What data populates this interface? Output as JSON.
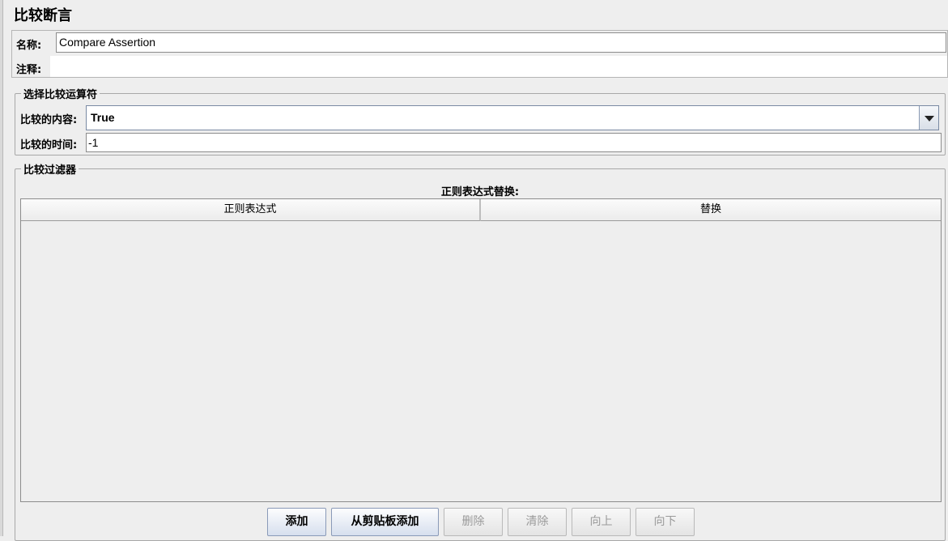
{
  "page": {
    "title": "比较断言"
  },
  "name_panel": {
    "name_label": "名称:",
    "name_value": "Compare Assertion",
    "comment_label": "注释:",
    "comment_value": ""
  },
  "operator_group": {
    "legend": "选择比较运算符",
    "content_label": "比较的内容:",
    "content_value": "True",
    "time_label": "比较的时间:",
    "time_value": "-1"
  },
  "filter_group": {
    "legend": "比较过滤器",
    "table_caption": "正则表达式替换:",
    "columns": [
      "正则表达式",
      "替换"
    ],
    "rows": []
  },
  "buttons": {
    "add": "添加",
    "add_from_clipboard": "从剪贴板添加",
    "delete": "删除",
    "clear": "清除",
    "up": "向上",
    "down": "向下"
  },
  "icons": {
    "combo_arrow": "triangle-down-icon"
  }
}
